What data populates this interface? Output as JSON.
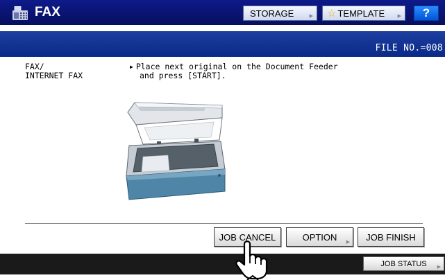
{
  "header": {
    "app_icon": "fax-machine-icon",
    "title": "FAX",
    "storage_label": "STORAGE",
    "template_label": "TEMPLATE",
    "template_icon": "star-icon",
    "help_label": "?"
  },
  "file_bar": {
    "file_no": "FILE NO.=008"
  },
  "main": {
    "mode_line1": "FAX/",
    "mode_line2": "INTERNET FAX",
    "message_line1": "Place next original on the Document Feeder",
    "message_line2": "and press [START]."
  },
  "actions": {
    "job_cancel": "JOB CANCEL",
    "option": "OPTION",
    "job_finish": "JOB FINISH"
  },
  "footer": {
    "job_status": "JOB STATUS"
  },
  "colors": {
    "header_bg": "#0e1a8a",
    "file_bar_bg": "#1e3ea0",
    "help_bg": "#0055d8",
    "footer_bg": "#1a1a1a"
  }
}
